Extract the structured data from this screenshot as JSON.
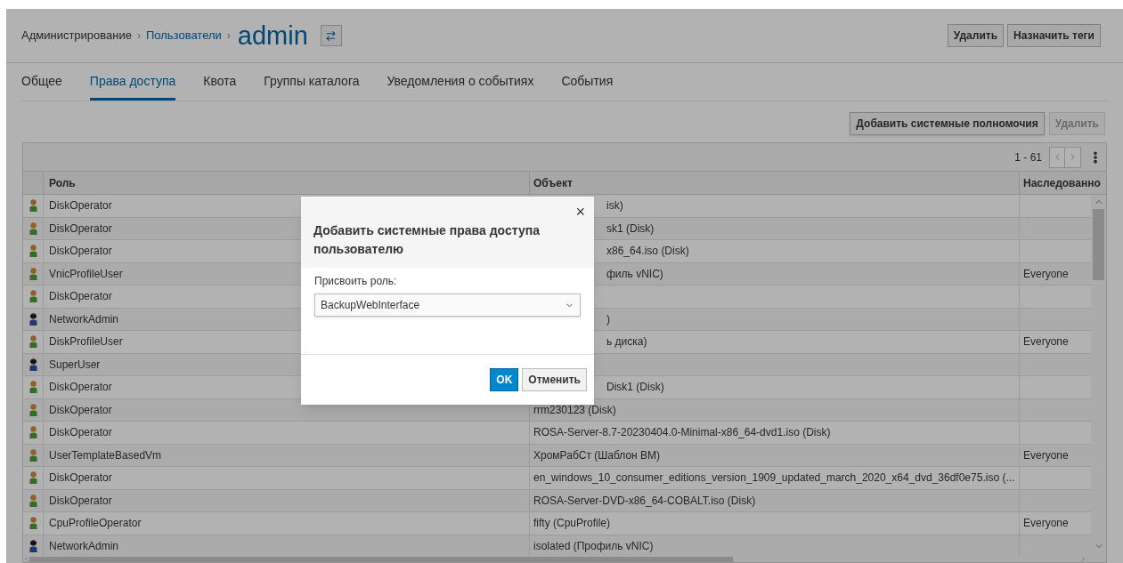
{
  "breadcrumb": {
    "items": [
      {
        "label": "Администрирование",
        "kind": "text"
      },
      {
        "label": "Пользователи",
        "kind": "link"
      }
    ],
    "separator": "›",
    "title": "admin"
  },
  "header_buttons": [
    "Удалить",
    "Назначить теги"
  ],
  "tabs": [
    {
      "label": "Общее",
      "selected": false
    },
    {
      "label": "Права доступа",
      "selected": true
    },
    {
      "label": "Квота",
      "selected": false
    },
    {
      "label": "Группы каталога",
      "selected": false
    },
    {
      "label": "Уведомления о событиях",
      "selected": false
    },
    {
      "label": "События",
      "selected": false
    }
  ],
  "toolbar": [
    {
      "label": "Добавить системные полномочия",
      "disabled": false
    },
    {
      "label": "Удалить",
      "disabled": true
    }
  ],
  "pager": {
    "range": "1 - 61"
  },
  "table": {
    "columns": [
      "Роль",
      "Объект",
      "Наследованно"
    ],
    "rows": [
      {
        "kind": "user",
        "role": "DiskOperator",
        "object": "isk)",
        "partial": true,
        "inherited": ""
      },
      {
        "kind": "user",
        "role": "DiskOperator",
        "object": "sk1 (Disk)",
        "partial": true,
        "inherited": ""
      },
      {
        "kind": "user",
        "role": "DiskOperator",
        "object": "x86_64.iso (Disk)",
        "partial": true,
        "inherited": ""
      },
      {
        "kind": "user",
        "role": "VnicProfileUser",
        "object": "филь vNIC)",
        "partial": true,
        "inherited": "Everyone"
      },
      {
        "kind": "user",
        "role": "DiskOperator",
        "object": "",
        "inherited": ""
      },
      {
        "kind": "admin",
        "role": "NetworkAdmin",
        "object": ")",
        "partial": true,
        "inherited": ""
      },
      {
        "kind": "user",
        "role": "DiskProfileUser",
        "object": "ь диска)",
        "partial": true,
        "inherited": "Everyone"
      },
      {
        "kind": "admin",
        "role": "SuperUser",
        "object": "",
        "inherited": ""
      },
      {
        "kind": "user",
        "role": "DiskOperator",
        "object": "Disk1 (Disk)",
        "partial": true,
        "inherited": ""
      },
      {
        "kind": "user",
        "role": "DiskOperator",
        "object": "rrm230123 (Disk)",
        "partial": false,
        "inherited": ""
      },
      {
        "kind": "user",
        "role": "DiskOperator",
        "object": "ROSA-Server-8.7-20230404.0-Minimal-x86_64-dvd1.iso (Disk)",
        "partial": false,
        "inherited": ""
      },
      {
        "kind": "user",
        "role": "UserTemplateBasedVm",
        "object": "ХромРабСт (Шаблон ВМ)",
        "partial": false,
        "inherited": "Everyone"
      },
      {
        "kind": "user",
        "role": "DiskOperator",
        "object": "en_windows_10_consumer_editions_version_1909_updated_march_2020_x64_dvd_36df0e75.iso (...",
        "partial": false,
        "inherited": ""
      },
      {
        "kind": "user",
        "role": "DiskOperator",
        "object": "ROSA-Server-DVD-x86_64-COBALT.iso (Disk)",
        "partial": false,
        "inherited": ""
      },
      {
        "kind": "user",
        "role": "CpuProfileOperator",
        "object": "fifty (CpuProfile)",
        "partial": false,
        "inherited": "Everyone"
      },
      {
        "kind": "admin",
        "role": "NetworkAdmin",
        "object": "isolated (Профиль vNIC)",
        "partial": false,
        "inherited": ""
      }
    ]
  },
  "dialog": {
    "title": "Добавить системные права доступа пользователю",
    "close": "×",
    "field_label": "Присвоить роль:",
    "value": "BackupWebInterface",
    "buttons": [
      {
        "label": "OK",
        "kind": "primary"
      },
      {
        "label": "Отменить",
        "kind": "default"
      }
    ]
  }
}
